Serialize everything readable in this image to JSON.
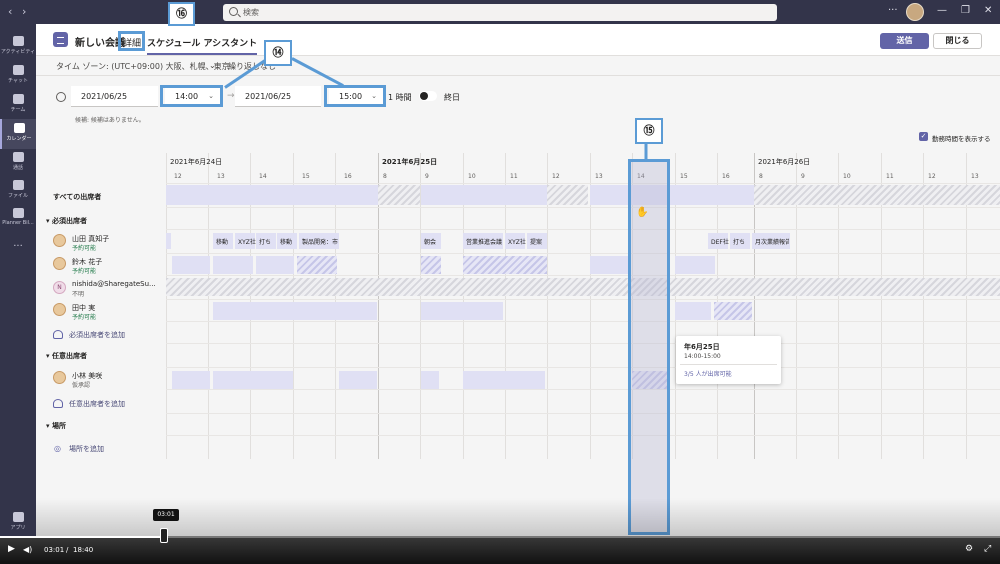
{
  "titlebar": {
    "search_placeholder": "検索"
  },
  "rail": {
    "items": [
      {
        "label": "アクティビティ"
      },
      {
        "label": "チャット"
      },
      {
        "label": "チーム"
      },
      {
        "label": "カレンダー"
      },
      {
        "label": "通話"
      },
      {
        "label": "ファイル"
      },
      {
        "label": "Planner Bil..."
      },
      {
        "label": "..."
      },
      {
        "label": "アプリ"
      }
    ]
  },
  "header": {
    "title": "新しい会議",
    "tab_details": "詳細",
    "tab_assistant": "スケジュール アシスタント",
    "send_label": "送信",
    "close_label": "閉じる"
  },
  "timezone": {
    "label": "タイム ゾーン: (UTC+09:00) 大阪、札幌、東京",
    "recurrence": "繰り返しなし"
  },
  "form": {
    "start_date": "2021/06/25",
    "start_time": "14:00",
    "end_date": "2021/06/25",
    "end_time": "15:00",
    "duration": "1 時間",
    "allday": "終日",
    "suggestion": "候補: 候補はありません。",
    "work_hours_label": "勤務時間を表示する"
  },
  "grid": {
    "dates": [
      "2021年6月24日",
      "2021年6月25日",
      "2021年6月26日"
    ],
    "hours": [
      "12",
      "13",
      "14",
      "15",
      "16",
      "8",
      "9",
      "10",
      "11",
      "12",
      "13",
      "14",
      "15",
      "16",
      "8",
      "9",
      "10",
      "11",
      "12",
      "13"
    ],
    "events": {
      "yamada": [
        "移動",
        "XYZ社",
        "打ち",
        "移動",
        "製品開発：市",
        "朝会",
        "営業推進会議",
        "XYZ社",
        "提案",
        "DEF社",
        "打ち",
        "月次業績報告"
      ]
    }
  },
  "people": {
    "all_attendees": "すべての出席者",
    "required_header": "必須出席者",
    "optional_header": "任意出席者",
    "location_header": "場所",
    "add_required": "必須出席者を追加",
    "add_optional": "任意出席者を追加",
    "add_location": "場所を追加",
    "required": [
      {
        "name": "山田 真知子",
        "status": "予約可能"
      },
      {
        "name": "鈴木 花子",
        "status": "予約可能"
      },
      {
        "name": "nishida@SharegateSu...",
        "status": "不明",
        "initial": "N"
      },
      {
        "name": "田中 実",
        "status": "予約可能"
      }
    ],
    "optional": [
      {
        "name": "小林 美咲",
        "status": "仮承認"
      }
    ]
  },
  "tooltip": {
    "date": "年6月25日",
    "time": "14:00-15:00",
    "availability": "3/5 人が出席可能"
  },
  "callouts": {
    "c14": "⑭",
    "c15": "⑮",
    "c16": "⑯"
  },
  "video": {
    "current": "03:01",
    "separator": "/",
    "total": "18:40",
    "tip": "03:01"
  }
}
